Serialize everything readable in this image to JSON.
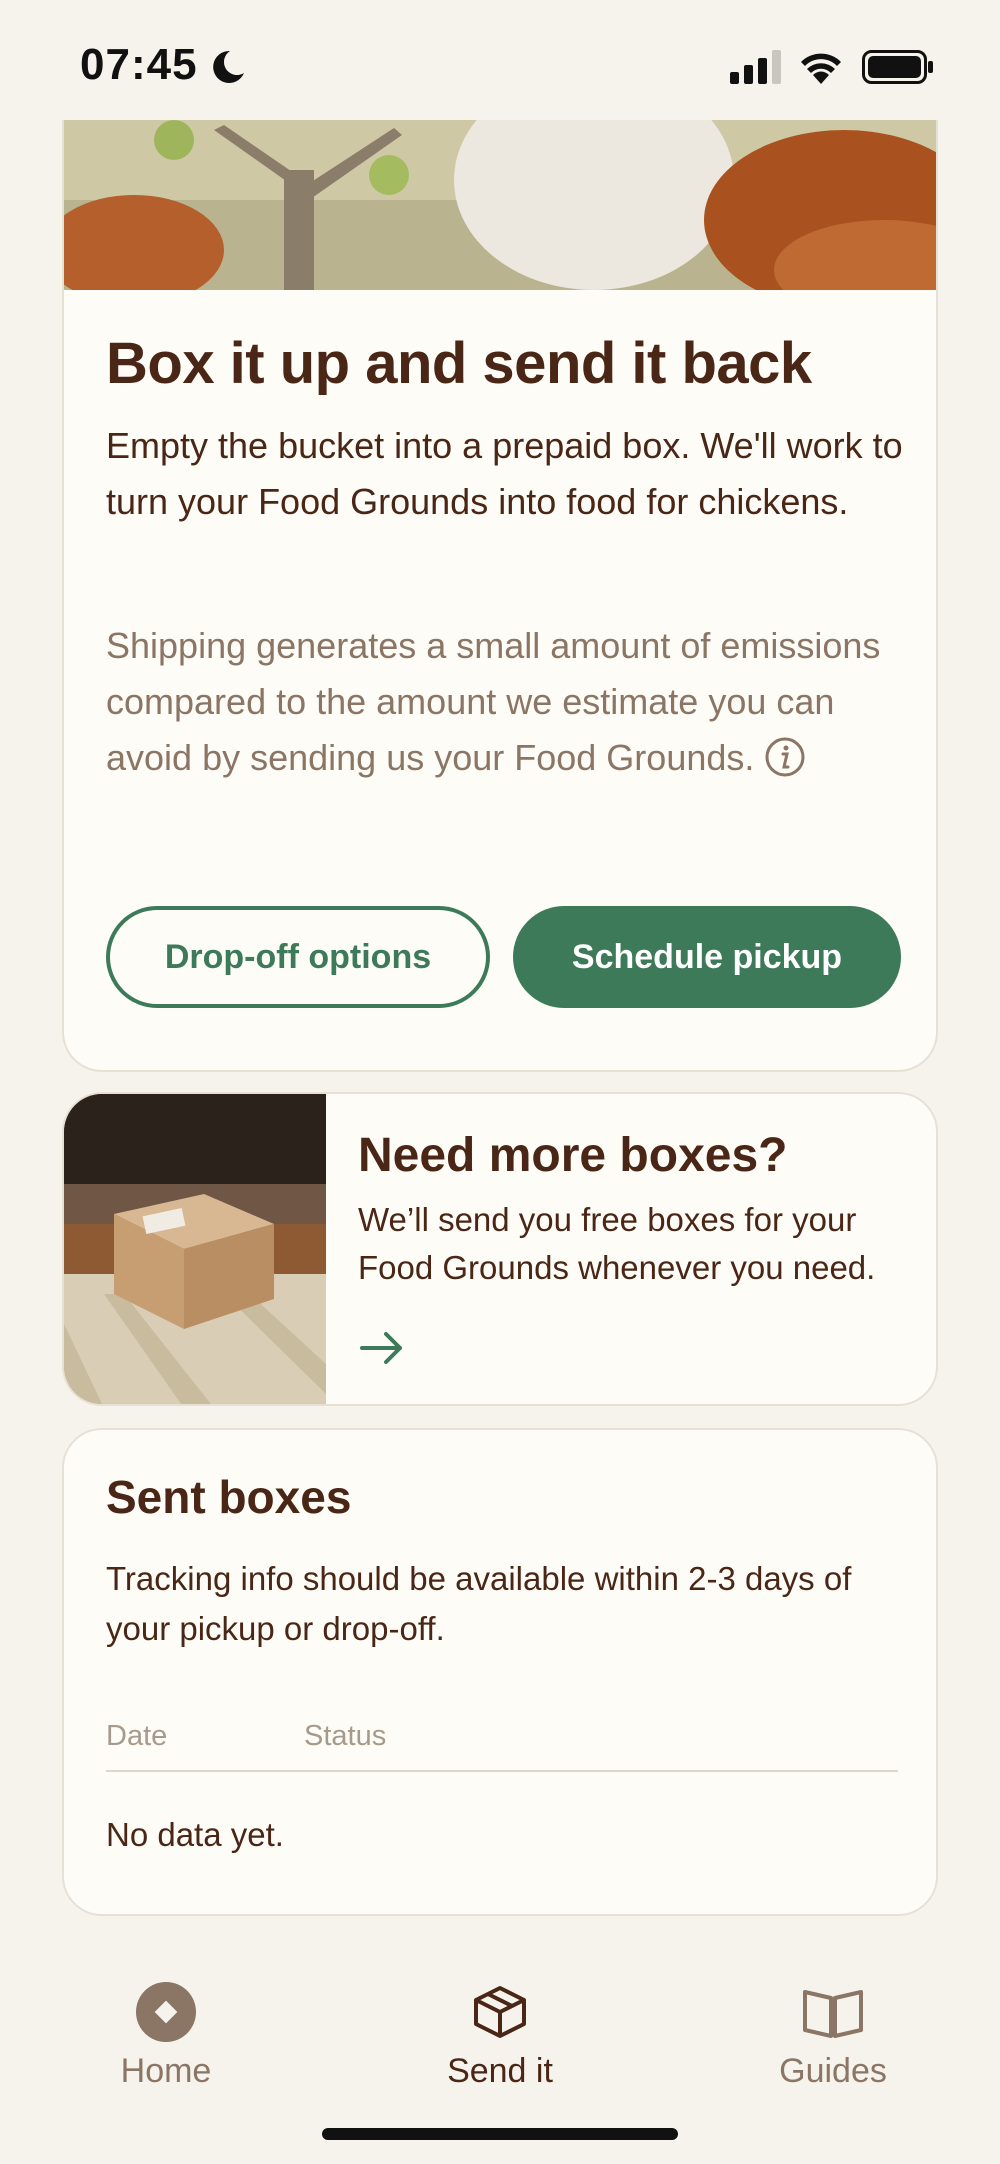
{
  "status_bar": {
    "time": "07:45"
  },
  "hero": {
    "title": "Box it up and send it back",
    "body": "Empty the bucket into a prepaid box. We'll work to turn your Food Grounds into food for chickens.",
    "note": "Shipping generates a small amount of emissions compared to the amount we estimate you can avoid by sending us your Food Grounds.",
    "drop_off_label": "Drop-off options",
    "pickup_label": "Schedule pickup"
  },
  "more_boxes": {
    "title": "Need more boxes?",
    "body": "We’ll send you free boxes for your Food Grounds whenever you need."
  },
  "sent_boxes": {
    "title": "Sent boxes",
    "body": "Tracking info should be available within 2-3 days of your pickup or drop-off.",
    "columns": [
      "Date",
      "Status"
    ],
    "empty_text": "No data yet."
  },
  "tabs": [
    {
      "label": "Home",
      "icon": "home-icon",
      "active": false
    },
    {
      "label": "Send it",
      "icon": "box-icon",
      "active": true
    },
    {
      "label": "Guides",
      "icon": "book-icon",
      "active": false
    }
  ],
  "colors": {
    "accent": "#3d7a59",
    "text": "#4a2616",
    "muted": "#8b7565",
    "background": "#f6f3ec"
  }
}
